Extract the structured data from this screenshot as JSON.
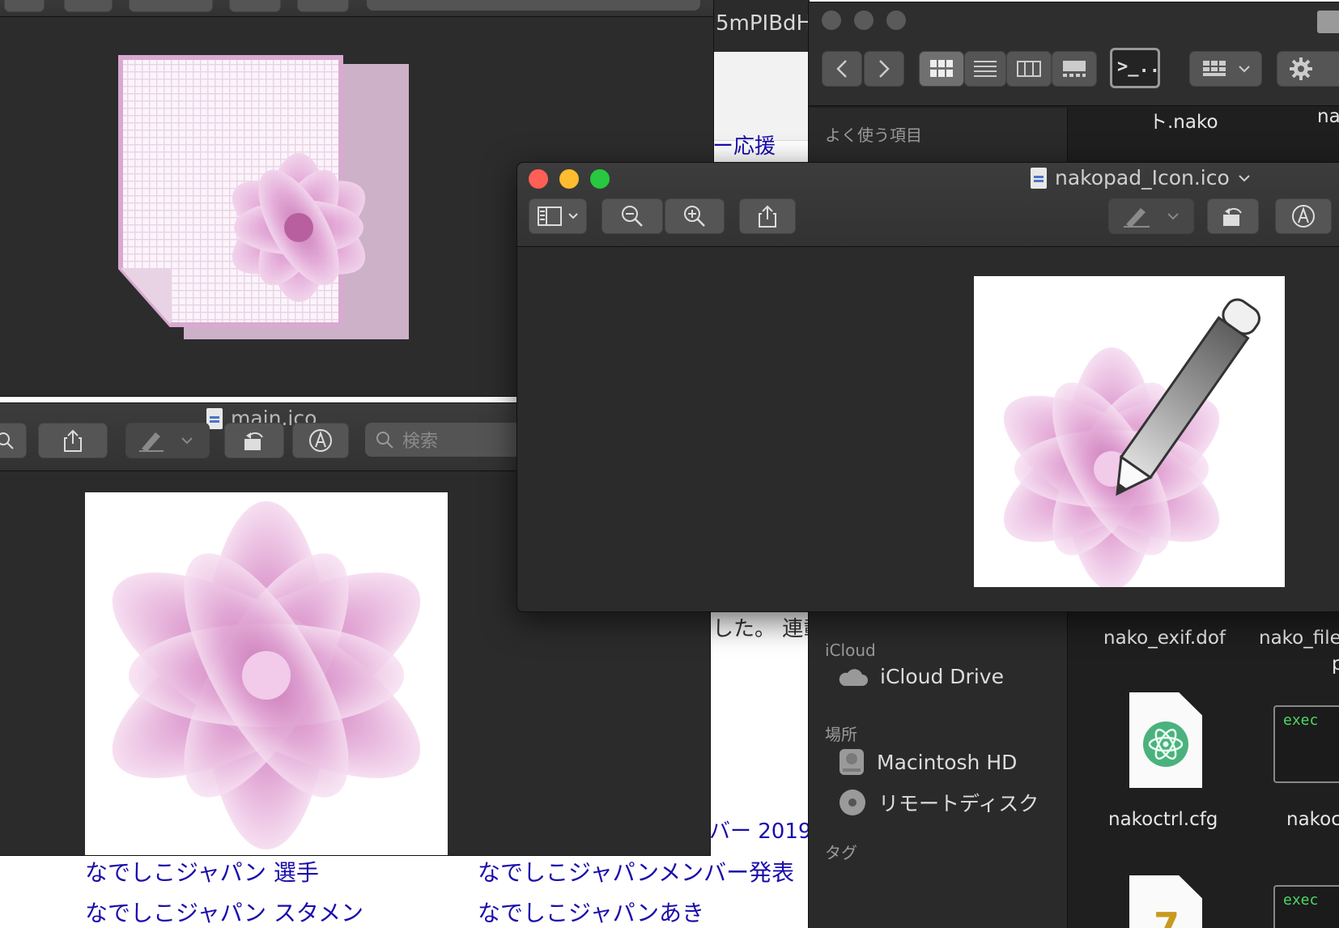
{
  "browser": {
    "url_fragment": "5mPIBdH",
    "fragments": {
      "heading_fragment": "ー応援",
      "text_fragment": "した。 連載",
      "member_year_fragment": "バー 2019"
    },
    "related_searches": [
      "なでしこジャパン 選手",
      "なでしこジャパンメンバー発表",
      "なでしこジャパン スタメン",
      "なでしこジャパンあき"
    ]
  },
  "main_window": {
    "title": "main.ico",
    "search_placeholder": "検索"
  },
  "preview_window": {
    "title": "nakopad_Icon.ico"
  },
  "finder": {
    "top_file_labels": [
      "ト.nako",
      "na"
    ],
    "sidebar": {
      "favorites_header": "よく使う項目",
      "icloud_header": "iCloud",
      "icloud_drive": "iCloud Drive",
      "places_header": "場所",
      "macintosh_hd": "Macintosh HD",
      "remote_disc": "リモートディスク",
      "tags_header": "タグ"
    },
    "files": {
      "nako_exif": "nako_exif.dof",
      "nako_file": "nako_file",
      "nako_file_line2": "p",
      "nakoctrl": "nakoctrl.cfg",
      "nakoc": "nakoc",
      "exec_label": "exec"
    }
  },
  "colors": {
    "traffic_red": "#fe5f57",
    "traffic_yellow": "#febc2e",
    "traffic_green": "#28c840",
    "petal_pink": "#d98fc8",
    "link_blue": "#1a0dab"
  },
  "icons": [
    "share-icon",
    "zoom-in-icon",
    "zoom-out-icon",
    "rotate-icon",
    "markup-icon",
    "sidebar-toggle-icon",
    "search-icon",
    "gear-icon",
    "terminal-icon",
    "cloud-icon",
    "disk-icon",
    "disc-icon"
  ]
}
